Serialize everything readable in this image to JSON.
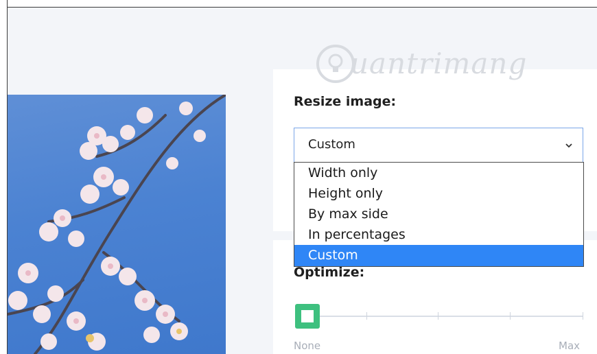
{
  "watermark": {
    "text": "uantrimang"
  },
  "resize": {
    "title": "Resize image:",
    "selected_value": "Custom",
    "options": [
      "Width only",
      "Height only",
      "By max side",
      "In percentages",
      "Custom"
    ],
    "selected_index": 4
  },
  "optimize": {
    "title": "Optimize:",
    "min_label": "None",
    "max_label": "Max",
    "level": 0
  },
  "colors": {
    "selected_option_bg": "#2f86f6",
    "slider_thumb": "#3ec07f",
    "select_border": "#7aa6e8"
  },
  "icons": [
    "chevron-down-icon",
    "lightbulb-icon"
  ]
}
